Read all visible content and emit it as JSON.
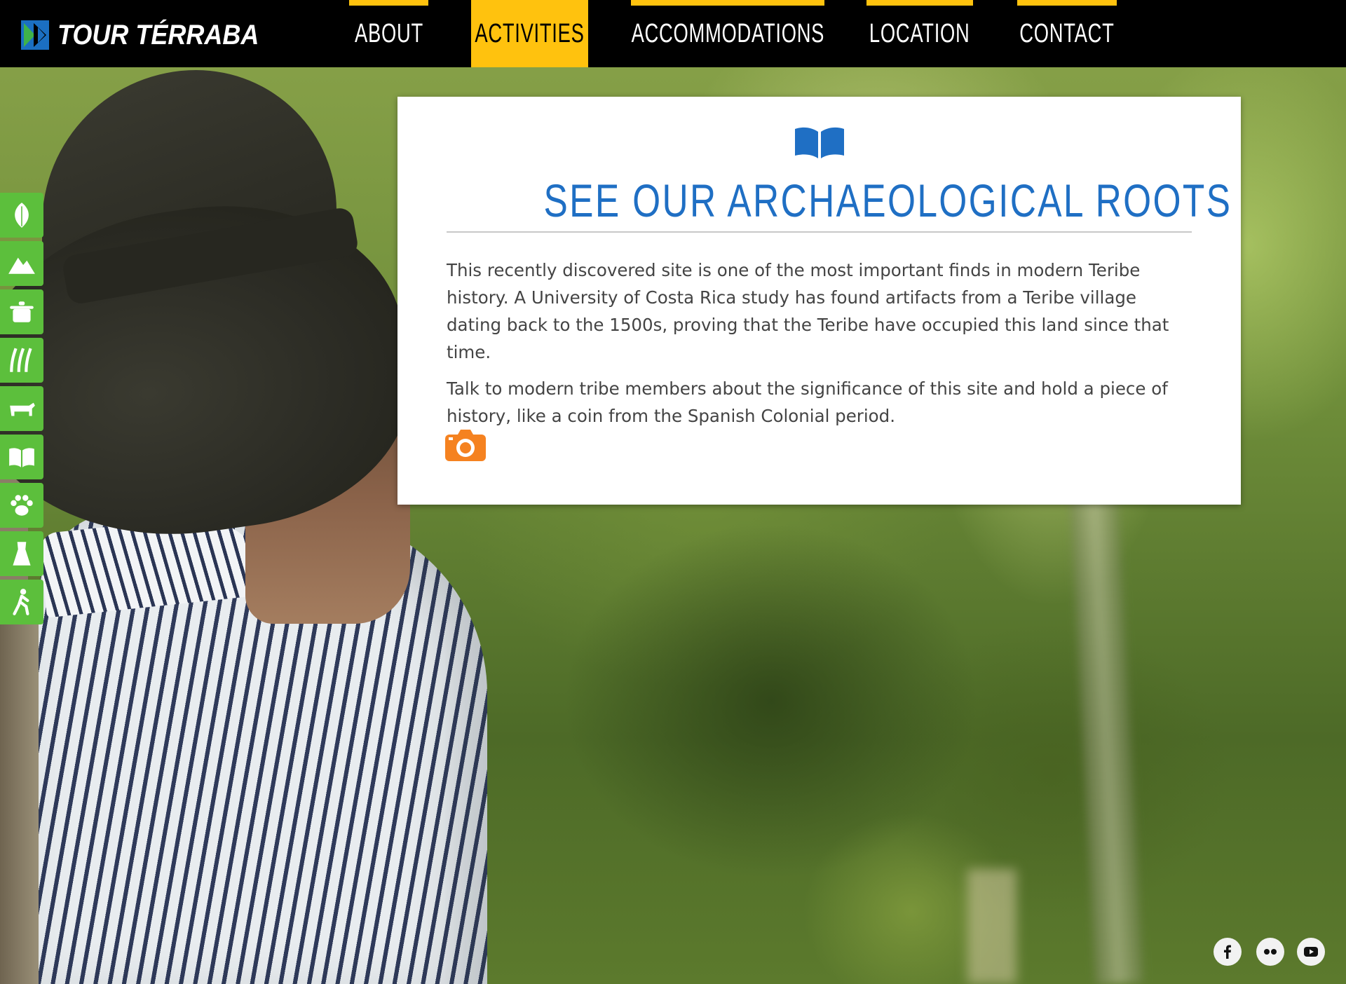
{
  "brand": {
    "name": "TOUR TÉRRABA"
  },
  "nav": {
    "items": [
      {
        "label": "ABOUT"
      },
      {
        "label": "ACTIVITIES",
        "active": true
      },
      {
        "label": "ACCOMMODATIONS"
      },
      {
        "label": "LOCATION"
      },
      {
        "label": "CONTACT"
      }
    ]
  },
  "sidebar": {
    "icons": [
      "leaf-icon",
      "mountain-icon",
      "cooking-pot-icon",
      "sugar-cane-icon",
      "cow-icon",
      "open-book-icon",
      "paw-icon",
      "dress-icon",
      "hiker-icon"
    ]
  },
  "card": {
    "icon": "open-book-icon",
    "title": "SEE OUR ARCHAEOLOGICAL ROOTS",
    "paragraphs": [
      "This recently discovered site is one of the most important finds in modern Teribe history. A University of Costa Rica study has found artifacts from a Teribe village dating back to the 1500s, proving that the Teribe have occupied this land since that time.",
      "Talk to modern tribe members about the significance of this site and hold a piece of history, like a coin from the Spanish Colonial period."
    ],
    "gallery_icon": "camera-icon"
  },
  "social": [
    "facebook-icon",
    "flickr-icon",
    "youtube-icon"
  ],
  "colors": {
    "nav_bg": "#000000",
    "accent_yellow": "#ffc20e",
    "title_blue": "#1f6fc4",
    "sidebar_green": "#5cbf3c",
    "camera_orange": "#f58220",
    "logo_blue": "#1b6fc2",
    "logo_green": "#3fb24a"
  }
}
